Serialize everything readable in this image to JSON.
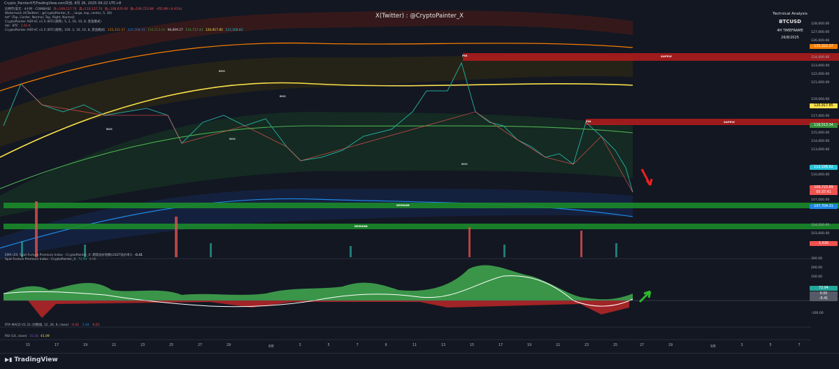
{
  "topbar": {
    "text": "Crypto_PainterX与TradingView.com共创, 8月 26, 2025 09:22 UTC+8"
  },
  "legend": {
    "line1": {
      "label": "比特币/美元 · 4小时 · COINBASE",
      "o": "开=109,117.74",
      "h": "高=110,127.74",
      "l": "低=108,670.00",
      "c": "收=109,723.89",
      "ch": "-455.89 (-0.41%)"
    },
    "line2": "Watermark (X(Twitter) : @CryptoPainter_X, ., large, top, center, 5, 30)",
    "line3": "txt\" (Top, Center, Normal, Top, Right, Normal)",
    "line4": "CryptoPainter ASR-VC v1.5 (BTC(调用), 5, 2, 16, 10, 8, 黑弦模式)",
    "line5": {
      "label": "Vol · BTC",
      "v": "1.01 K"
    },
    "line6": {
      "label": "CryptoPainter ASR-VC v1.5 (BTC(调用), 100, 2, 16, 10, 8, 黑弦模式)",
      "values": [
        "135,322.37",
        "107,704.31",
        "116,513.34",
        "98,899.27",
        "114,717.43",
        "120,917.85",
        "112,168.82"
      ]
    }
  },
  "watermark": "X(Twitter) : @CryptoPainter_X",
  "info_box": {
    "line1": "Technical Analysis",
    "line2": "BTCUSD",
    "line3": "4H TIMEFRAME",
    "line4": "26/8/2025"
  },
  "zones": {
    "supply1": "SUPPLY",
    "supply2": "SUPPLY",
    "demand1": "DEMAND",
    "demand2": "DEMAND",
    "bos": [
      "BOS",
      "BOS",
      "BOS",
      "BOS",
      "BOS"
    ],
    "poi1": "POI",
    "poi2": "POI"
  },
  "price_axis": [
    "128,000.00",
    "127,000.00",
    "126,000.00",
    "124,000.00",
    "123,000.00",
    "122,000.00",
    "121,000.00",
    "119,000.00",
    "118,000.00",
    "117,000.00",
    "116,000.00",
    "115,000.00",
    "114,000.00",
    "113,000.00",
    "111,000.00",
    "110,000.00",
    "107,000.00",
    "106,000.00",
    "104,000.00",
    "103,000.00"
  ],
  "price_tags": [
    {
      "text": "135,322.37",
      "color": "#f57c00"
    },
    {
      "text": "120,917.85",
      "color": "#f9e04a"
    },
    {
      "text": "116,513.34",
      "color": "#388e3c"
    },
    {
      "text": "112,168.82",
      "color": "#26c6da"
    },
    {
      "text": "109,723.89",
      "color": "#ef5350"
    },
    {
      "text": "00:37:41",
      "color": "#ef5350"
    },
    {
      "text": "107,704.31",
      "color": "#1e88e5"
    },
    {
      "text": "1.01K",
      "color": "#ef5350"
    }
  ],
  "osc_legend": {
    "line1": {
      "label": "EMA (20, Spot-Furture Premium Index - CryptoPainter_X: 期现溢价指数(USDT溢价率))",
      "v": "-0.41"
    },
    "line2": {
      "label": "Spot-Furture Premium Index - CryptoPainter_X",
      "v1": "72.94",
      "v2": "0.00"
    }
  },
  "osc_axis": [
    "300.00",
    "200.00",
    "100.00",
    "-100.00"
  ],
  "osc_tags": [
    {
      "text": "72.94",
      "color": "#26a69a"
    },
    {
      "text": "0.00",
      "color": "#555a66"
    },
    {
      "text": "-0.41",
      "color": "#555a66"
    }
  ],
  "macd_legend": {
    "label": "RTA MACD V2.31 (对数值, 12, 26, 9, close)",
    "v1": "-0.41",
    "v2": "-1.64",
    "v3": "-0.61"
  },
  "rsi_legend": {
    "label": "RSI (14, close)",
    "v1": "31.18",
    "v2": "41.09"
  },
  "x_axis": [
    "15",
    "17",
    "19",
    "21",
    "23",
    "25",
    "27",
    "29",
    "8月",
    "3",
    "5",
    "7",
    "9",
    "11",
    "13",
    "15",
    "17",
    "19",
    "21",
    "23",
    "25",
    "27",
    "29",
    "9月",
    "3",
    "5",
    "7"
  ],
  "bottom": {
    "logo": "TradingView"
  },
  "colors": {
    "bg": "#131722",
    "bull": "#26a69a",
    "bear": "#ef5350",
    "supply": "#b71c1c",
    "demand": "#1b8a2a"
  }
}
